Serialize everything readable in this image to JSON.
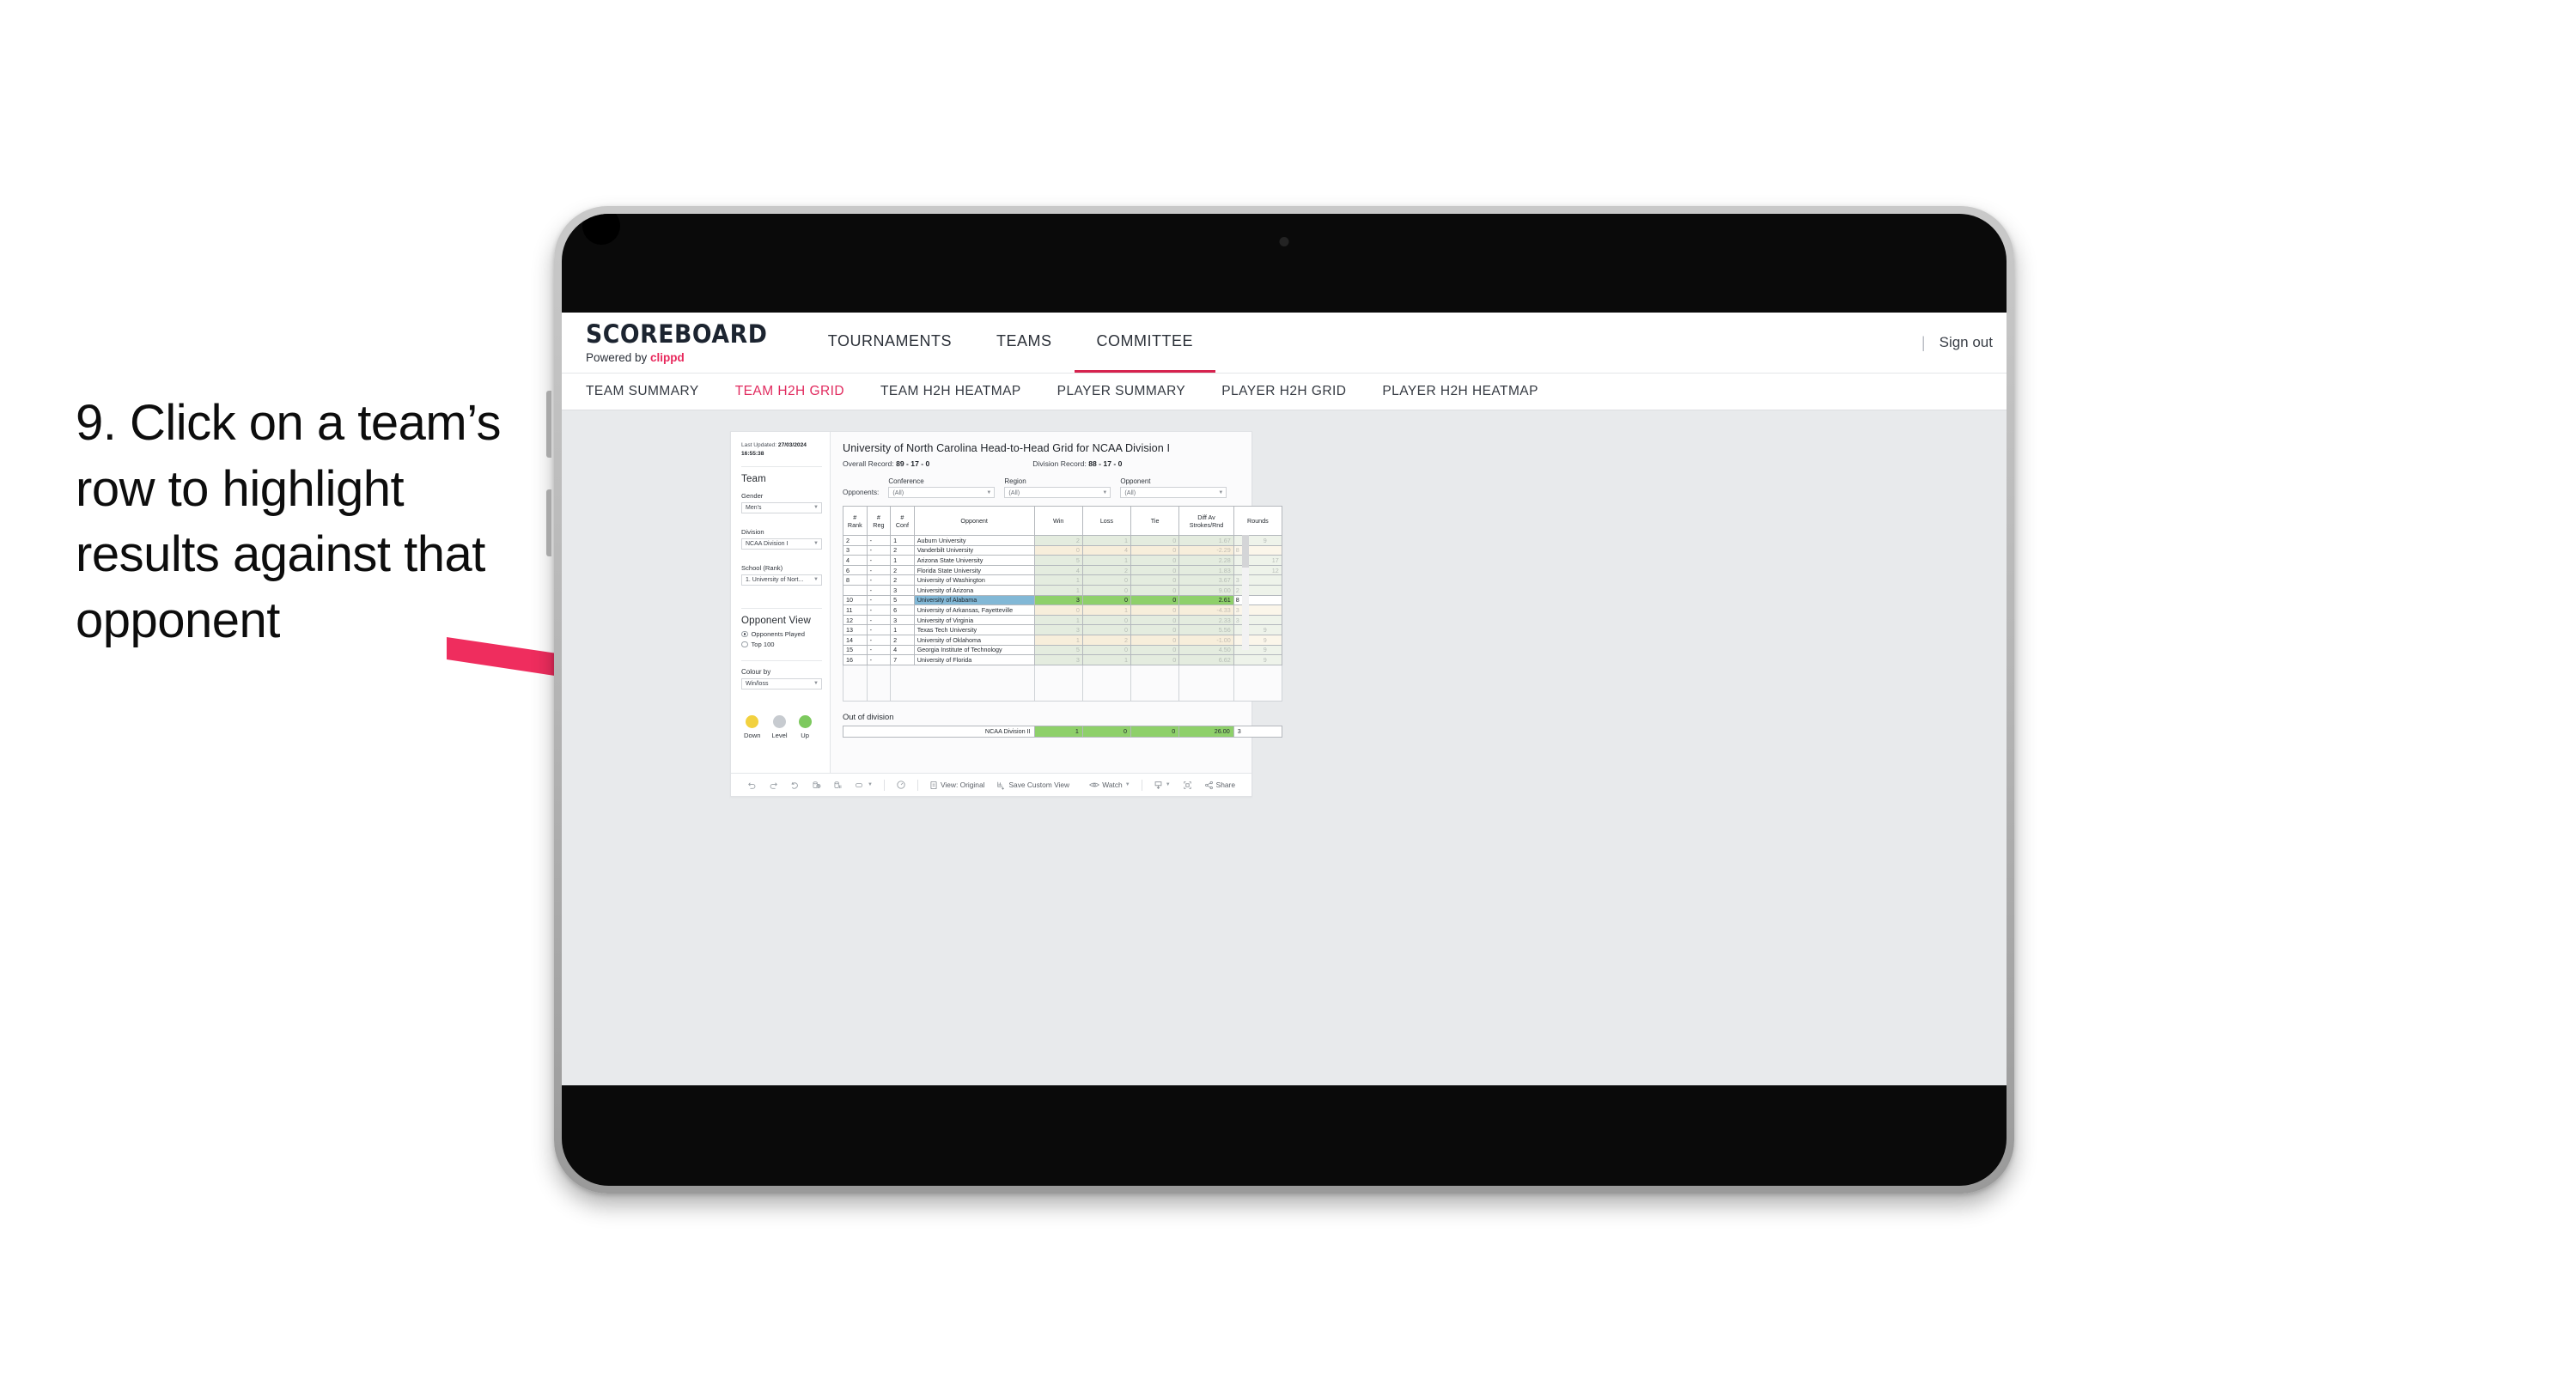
{
  "caption": {
    "text": "9. Click on a team’s row to highlight results against that opponent"
  },
  "app": {
    "logo_word": "SCOREBOARD",
    "logo_sub_prefix": "Powered by ",
    "logo_sub_brand": "clippd",
    "top_nav": [
      {
        "label": "TOURNAMENTS",
        "active": false
      },
      {
        "label": "TEAMS",
        "active": false
      },
      {
        "label": "COMMITTEE",
        "active": true
      }
    ],
    "sign_out": "Sign out",
    "divider": "|",
    "sub_nav": [
      {
        "label": "TEAM SUMMARY",
        "active": false
      },
      {
        "label": "TEAM H2H GRID",
        "active": true
      },
      {
        "label": "TEAM H2H HEATMAP",
        "active": false
      },
      {
        "label": "PLAYER SUMMARY",
        "active": false
      },
      {
        "label": "PLAYER H2H GRID",
        "active": false
      },
      {
        "label": "PLAYER H2H HEATMAP",
        "active": false
      }
    ]
  },
  "sidebar": {
    "last_updated_label": "Last Updated:",
    "last_updated_value": "27/03/2024 16:55:38",
    "team_heading": "Team",
    "gender_label": "Gender",
    "gender_value": "Men’s",
    "division_label": "Division",
    "division_value": "NCAA Division I",
    "school_label": "School (Rank)",
    "school_value": "1. University of Nort...",
    "opponent_view_heading": "Opponent View",
    "opponent_view_options": [
      {
        "label": "Opponents Played",
        "selected": true
      },
      {
        "label": "Top 100",
        "selected": false
      }
    ],
    "colour_by_label": "Colour by",
    "colour_by_value": "Win/loss",
    "legend": [
      {
        "label": "Down",
        "color": "#f2d13f"
      },
      {
        "label": "Level",
        "color": "#c7cbd0"
      },
      {
        "label": "Up",
        "color": "#7dc95e"
      }
    ]
  },
  "main": {
    "title": "University of North Carolina Head-to-Head Grid for NCAA Division I",
    "overall_record_label": "Overall Record:",
    "overall_record_value": "89 - 17 - 0",
    "division_record_label": "Division Record:",
    "division_record_value": "88 - 17 - 0",
    "opponents_label": "Opponents:",
    "filters": [
      {
        "label": "Conference",
        "value": "(All)"
      },
      {
        "label": "Region",
        "value": "(All)"
      },
      {
        "label": "Opponent",
        "value": "(All)"
      }
    ],
    "columns": [
      "# Rank",
      "# Reg",
      "# Conf",
      "Opponent",
      "Win",
      "Loss",
      "Tie",
      "Diff Av Strokes/Rnd",
      "Rounds"
    ],
    "column_lines": [
      [
        "#",
        "Rank"
      ],
      [
        "#",
        "Reg"
      ],
      [
        "#",
        "Conf"
      ],
      [
        "Opponent"
      ],
      [
        "Win"
      ],
      [
        "Loss"
      ],
      [
        "Tie"
      ],
      [
        "Diff Av",
        "Strokes/Rnd"
      ],
      [
        "Rounds"
      ]
    ],
    "rows": [
      {
        "rank": "2",
        "reg": "-",
        "conf": "1",
        "opponent": "Auburn University",
        "win": "2",
        "loss": "1",
        "tie": "0",
        "diff": "1.67",
        "rounds": "9",
        "result": "win",
        "selected": false
      },
      {
        "rank": "3",
        "reg": "-",
        "conf": "2",
        "opponent": "Vanderbilt University",
        "win": "0",
        "loss": "4",
        "tie": "0",
        "diff": "-2.29",
        "rounds": "8",
        "result": "loss",
        "selected": false
      },
      {
        "rank": "4",
        "reg": "-",
        "conf": "1",
        "opponent": "Arizona State University",
        "win": "5",
        "loss": "1",
        "tie": "0",
        "diff": "2.28",
        "rounds": "17",
        "result": "win",
        "selected": false
      },
      {
        "rank": "6",
        "reg": "-",
        "conf": "2",
        "opponent": "Florida State University",
        "win": "4",
        "loss": "2",
        "tie": "0",
        "diff": "1.83",
        "rounds": "12",
        "result": "win",
        "selected": false
      },
      {
        "rank": "8",
        "reg": "-",
        "conf": "2",
        "opponent": "University of Washington",
        "win": "1",
        "loss": "0",
        "tie": "0",
        "diff": "3.67",
        "rounds": "3",
        "result": "win",
        "selected": false
      },
      {
        "rank": "",
        "reg": "-",
        "conf": "3",
        "opponent": "University of Arizona",
        "win": "1",
        "loss": "0",
        "tie": "0",
        "diff": "9.00",
        "rounds": "2",
        "result": "win",
        "selected": false
      },
      {
        "rank": "10",
        "reg": "-",
        "conf": "5",
        "opponent": "University of Alabama",
        "win": "3",
        "loss": "0",
        "tie": "0",
        "diff": "2.61",
        "rounds": "8",
        "result": "win",
        "selected": true
      },
      {
        "rank": "11",
        "reg": "-",
        "conf": "6",
        "opponent": "University of Arkansas, Fayetteville",
        "win": "0",
        "loss": "1",
        "tie": "0",
        "diff": "-4.33",
        "rounds": "3",
        "result": "loss",
        "selected": false
      },
      {
        "rank": "12",
        "reg": "-",
        "conf": "3",
        "opponent": "University of Virginia",
        "win": "1",
        "loss": "0",
        "tie": "0",
        "diff": "2.33",
        "rounds": "3",
        "result": "win",
        "selected": false
      },
      {
        "rank": "13",
        "reg": "-",
        "conf": "1",
        "opponent": "Texas Tech University",
        "win": "3",
        "loss": "0",
        "tie": "0",
        "diff": "5.56",
        "rounds": "9",
        "result": "win",
        "selected": false
      },
      {
        "rank": "14",
        "reg": "-",
        "conf": "2",
        "opponent": "University of Oklahoma",
        "win": "1",
        "loss": "2",
        "tie": "0",
        "diff": "-1.00",
        "rounds": "9",
        "result": "loss",
        "selected": false
      },
      {
        "rank": "15",
        "reg": "-",
        "conf": "4",
        "opponent": "Georgia Institute of Technology",
        "win": "5",
        "loss": "0",
        "tie": "0",
        "diff": "4.50",
        "rounds": "9",
        "result": "win",
        "selected": false
      },
      {
        "rank": "16",
        "reg": "-",
        "conf": "7",
        "opponent": "University of Florida",
        "win": "3",
        "loss": "1",
        "tie": "0",
        "diff": "6.62",
        "rounds": "9",
        "result": "win",
        "selected": false
      }
    ],
    "out_of_division": {
      "title": "Out of division",
      "rows": [
        {
          "label": "NCAA Division II",
          "win": "1",
          "loss": "0",
          "tie": "0",
          "diff": "26.00",
          "rounds": "3"
        }
      ]
    }
  },
  "toolbar": {
    "items": [
      {
        "name": "undo-icon",
        "label": "",
        "icon": "undo"
      },
      {
        "name": "redo-icon",
        "label": "",
        "icon": "redo"
      },
      {
        "name": "revert-icon",
        "label": "",
        "icon": "revert"
      },
      {
        "name": "refresh-data-icon",
        "label": "",
        "icon": "refresh"
      },
      {
        "name": "pause-updates-icon",
        "label": "",
        "icon": "pause"
      },
      {
        "name": "view-mode-icon",
        "label": "",
        "icon": "device"
      },
      {
        "name": "alerts-icon",
        "label": "",
        "icon": "alert"
      },
      {
        "name": "view-original",
        "label": "View: Original",
        "icon": "view"
      },
      {
        "name": "save-custom-view",
        "label": "Save Custom View",
        "icon": "save"
      },
      {
        "name": "watch-button",
        "label": "Watch",
        "icon": "watch"
      },
      {
        "name": "download-button",
        "label": "",
        "icon": "download"
      },
      {
        "name": "fullscreen-button",
        "label": "",
        "icon": "fullscreen"
      },
      {
        "name": "share-button",
        "label": "Share",
        "icon": "share"
      }
    ],
    "view_original": "View: Original",
    "save_custom_view": "Save Custom View",
    "watch": "Watch",
    "share": "Share"
  },
  "colors": {
    "accent_pink": "#e8285c",
    "arrow": "#ef2d5e",
    "win_green": "#8ed06a",
    "selected_blue": "#82b8d6",
    "loss_tan": "#f7eedb"
  }
}
